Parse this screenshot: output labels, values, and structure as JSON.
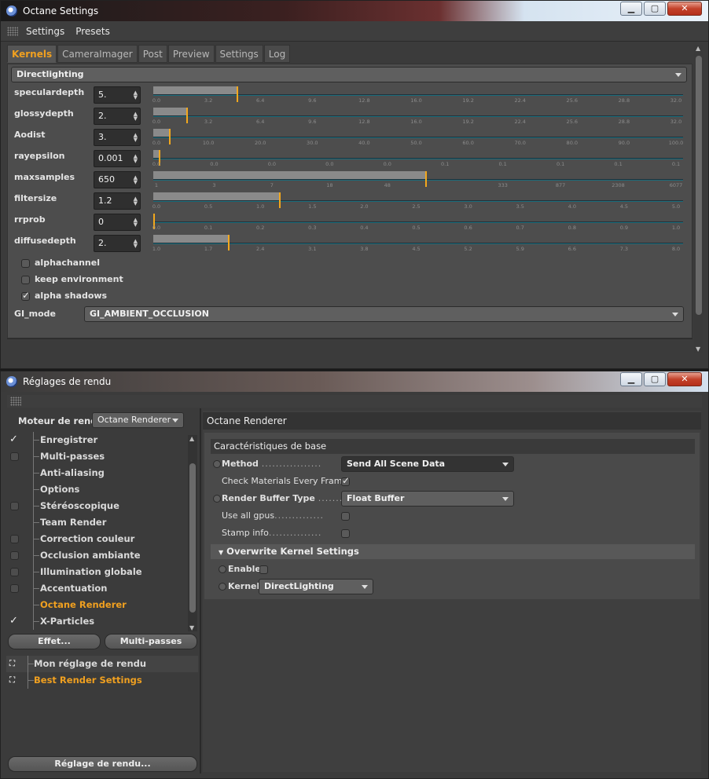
{
  "win1": {
    "title": "Octane Settings",
    "menu": [
      "Settings",
      "Presets"
    ],
    "tabs": [
      "Kernels",
      "CameraImager",
      "Post",
      "Preview",
      "Settings",
      "Log"
    ],
    "kernel_select": "Directlighting",
    "params": [
      {
        "label": "specular depth",
        "name": "speculardepth",
        "value": "5.",
        "fraction": 0.16,
        "ticks": [
          "0.0",
          "3.2",
          "6.4",
          "9.6",
          "12.8",
          "16.0",
          "19.2",
          "22.4",
          "25.6",
          "28.8",
          "32.0"
        ]
      },
      {
        "label": "glossy depth",
        "name": "glossydepth",
        "value": "2.",
        "fraction": 0.063,
        "ticks": [
          "0.0",
          "3.2",
          "6.4",
          "9.6",
          "12.8",
          "16.0",
          "19.2",
          "22.4",
          "25.6",
          "28.8",
          "32.0"
        ]
      },
      {
        "label": "AO dist",
        "name": "Aodist",
        "value": "3.",
        "fraction": 0.03,
        "ticks": [
          "0.0",
          "10.0",
          "20.0",
          "30.0",
          "40.0",
          "50.0",
          "60.0",
          "70.0",
          "80.0",
          "90.0",
          "100.0"
        ]
      },
      {
        "label": "ray epsilon",
        "name": "rayepsilon",
        "value": "0.001",
        "fraction": 0.01,
        "ticks": [
          "0.0",
          "0.0",
          "0.0",
          "0.0",
          "0.0",
          "0.1",
          "0.1",
          "0.1",
          "0.1",
          "0.1"
        ]
      },
      {
        "label": "max samples",
        "name": "maxsamples",
        "value": "650",
        "fraction": 0.52,
        "ticks": [
          "1",
          "3",
          "7",
          "18",
          "48",
          "",
          "333",
          "877",
          "2308",
          "6077"
        ]
      },
      {
        "label": "filter size",
        "name": "filtersize",
        "value": "1.2",
        "fraction": 0.24,
        "ticks": [
          "0.0",
          "0.5",
          "1.0",
          "1.5",
          "2.0",
          "2.5",
          "3.0",
          "3.5",
          "4.0",
          "4.5",
          "5.0"
        ]
      },
      {
        "label": "rr prob",
        "name": "rrprob",
        "value": "0",
        "fraction": 0.0,
        "ticks": [
          "0.0",
          "0.1",
          "0.2",
          "0.3",
          "0.4",
          "0.5",
          "0.6",
          "0.7",
          "0.8",
          "0.9",
          "1.0"
        ]
      },
      {
        "label": "diffuse depth",
        "name": "diffusedepth",
        "value": "2.",
        "fraction": 0.143,
        "ticks": [
          "1.0",
          "1.7",
          "2.4",
          "3.1",
          "3.8",
          "4.5",
          "5.2",
          "5.9",
          "6.6",
          "7.3",
          "8.0"
        ]
      }
    ],
    "checks": [
      {
        "label": "alphachannel",
        "checked": false
      },
      {
        "label": "keep environment",
        "checked": false
      },
      {
        "label": "alpha shadows",
        "checked": true
      }
    ],
    "gi_label": "GI_mode",
    "gi_value": "GI_AMBIENT_OCCLUSION"
  },
  "win2": {
    "title": "Réglages de rendu",
    "engine_label": "Moteur de rendu",
    "engine_value": "Octane Renderer",
    "list": [
      {
        "label": "Enregistrer",
        "checkbox": "checked"
      },
      {
        "label": "Multi-passes",
        "checkbox": "empty"
      },
      {
        "label": "Anti-aliasing",
        "checkbox": "none"
      },
      {
        "label": "Options",
        "checkbox": "none"
      },
      {
        "label": "Stéréoscopique",
        "checkbox": "empty"
      },
      {
        "label": "Team Render",
        "checkbox": "none"
      },
      {
        "label": "Correction couleur",
        "checkbox": "empty"
      },
      {
        "label": "Occlusion ambiante",
        "checkbox": "empty"
      },
      {
        "label": "Illumination globale",
        "checkbox": "empty"
      },
      {
        "label": "Accentuation",
        "checkbox": "empty"
      },
      {
        "label": "Octane Renderer",
        "checkbox": "none",
        "selected": true
      },
      {
        "label": "X-Particles",
        "checkbox": "checked"
      }
    ],
    "effect_button": "Effet...",
    "multipass_button": "Multi-passes",
    "presets": [
      {
        "label": "Mon réglage de rendu",
        "selected": false
      },
      {
        "label": "Best Render Settings",
        "selected": true
      }
    ],
    "render_settings_button": "Réglage de rendu...",
    "right_title": "Octane Renderer",
    "basic_section": "Caractéristiques de base",
    "method_label": "Method",
    "method_value": "Send All Scene Data",
    "check_materials_label": "Check Materials Every Frame",
    "buffer_label": "Render Buffer Type",
    "buffer_value": "Float Buffer",
    "use_all_gpus_label": "Use all gpus",
    "stamp_label": "Stamp info",
    "overwrite_section": "Overwrite Kernel Settings",
    "enable_label": "Enable",
    "kernel_label": "Kernel",
    "kernel_value": "DirectLighting"
  }
}
